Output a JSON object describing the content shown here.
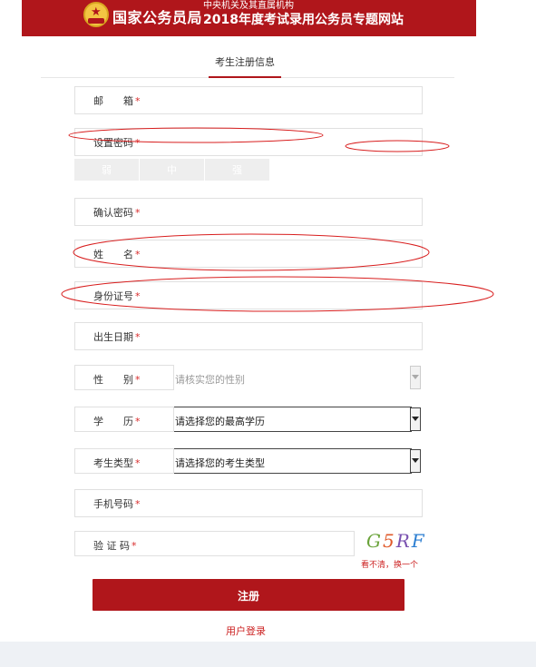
{
  "header": {
    "brand": "国家公务员局",
    "subtitle": "中央机关及其直属机构",
    "site_title": "2018年度考试录用公务员专题网站"
  },
  "tab": {
    "label": "考生注册信息"
  },
  "required_mark": "*",
  "fields": {
    "email": {
      "label": "邮　　箱"
    },
    "password": {
      "label": "设置密码"
    },
    "confirm_password": {
      "label": "确认密码"
    },
    "name": {
      "label": "姓　　名"
    },
    "id_number": {
      "label": "身份证号"
    },
    "birth_date": {
      "label": "出生日期"
    },
    "gender": {
      "label": "性　　别",
      "value": "请核实您的性别"
    },
    "education": {
      "label": "学　　历",
      "value": "请选择您的最高学历"
    },
    "candidate_type": {
      "label": "考生类型",
      "value": "请选择您的考生类型"
    },
    "phone": {
      "label": "手机号码"
    },
    "captcha": {
      "label": "验 证 码"
    }
  },
  "strength": {
    "weak": "弱",
    "medium": "中",
    "strong": "强"
  },
  "captcha": {
    "chars": [
      "G",
      "5",
      "R",
      "F"
    ],
    "refresh_label": "看不清，换一个"
  },
  "actions": {
    "submit_label": "注册",
    "login_label": "用户登录"
  },
  "colors": {
    "brand_red": "#b0161b",
    "annotation_red": "#d81e1e",
    "required_red": "#d82a2a"
  }
}
